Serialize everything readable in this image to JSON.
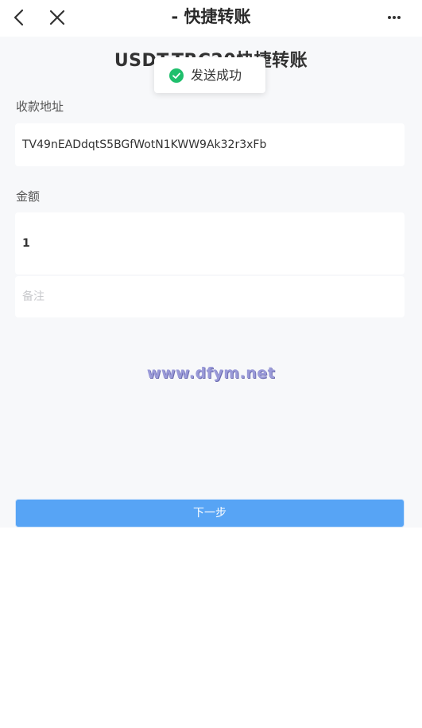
{
  "navbar": {
    "title": "- 快捷转账",
    "back_icon": "chevron-left-icon",
    "close_icon": "close-icon",
    "more_icon": "more-horizontal-icon"
  },
  "page": {
    "heading": "USDT-TRC20快捷转账"
  },
  "form": {
    "address_label": "收款地址",
    "address_value": "TV49nEADdqtS5BGfWotN1KWW9Ak32r3xFb",
    "amount_label": "金额",
    "amount_value": "1",
    "memo_placeholder": "备注",
    "memo_value": ""
  },
  "watermark": "www.dfym.net",
  "submit_label": "下一步",
  "toast": {
    "text": "发送成功",
    "icon": "check-circle-icon"
  },
  "colors": {
    "accent": "#57a4f5",
    "success": "#1fbf6c",
    "background": "#f7f8fa"
  }
}
